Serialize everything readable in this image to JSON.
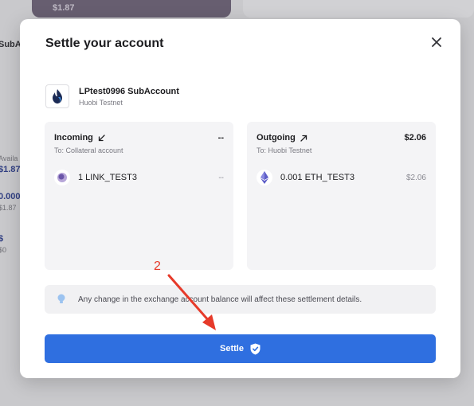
{
  "background": {
    "card_amount": "$1.87",
    "subaccount_fragment": "SubAcc",
    "available_fragment": "Availa",
    "value_1": "$1.87",
    "value_2": "0.000",
    "value_3": "$1.87",
    "value_4": "$",
    "value_5": "$0"
  },
  "modal": {
    "title": "Settle your account",
    "close_icon": "close-icon",
    "account": {
      "name": "LPtest0996 SubAccount",
      "exchange": "Huobi Testnet",
      "logo_icon": "huobi-flame-icon"
    },
    "incoming": {
      "label": "Incoming",
      "total": "--",
      "to": "To: Collateral account",
      "asset": "1 LINK_TEST3",
      "asset_value": "--",
      "arrow_icon": "arrow-down-left-icon",
      "asset_icon": "link-token-icon"
    },
    "outgoing": {
      "label": "Outgoing",
      "total": "$2.06",
      "to": "To: Huobi Testnet",
      "asset": "0.001 ETH_TEST3",
      "asset_value": "$2.06",
      "arrow_icon": "arrow-up-right-icon",
      "asset_icon": "ethereum-icon"
    },
    "info": {
      "text": "Any change in the exchange account balance will affect these settlement details.",
      "icon": "lightbulb-icon"
    },
    "settle_button": {
      "label": "Settle",
      "icon": "shield-check-icon"
    }
  },
  "annotation": {
    "step_number": "2"
  },
  "colors": {
    "primary": "#2f6fe0",
    "annotation": "#e63a2a",
    "panel_bg": "#f4f4f6"
  }
}
